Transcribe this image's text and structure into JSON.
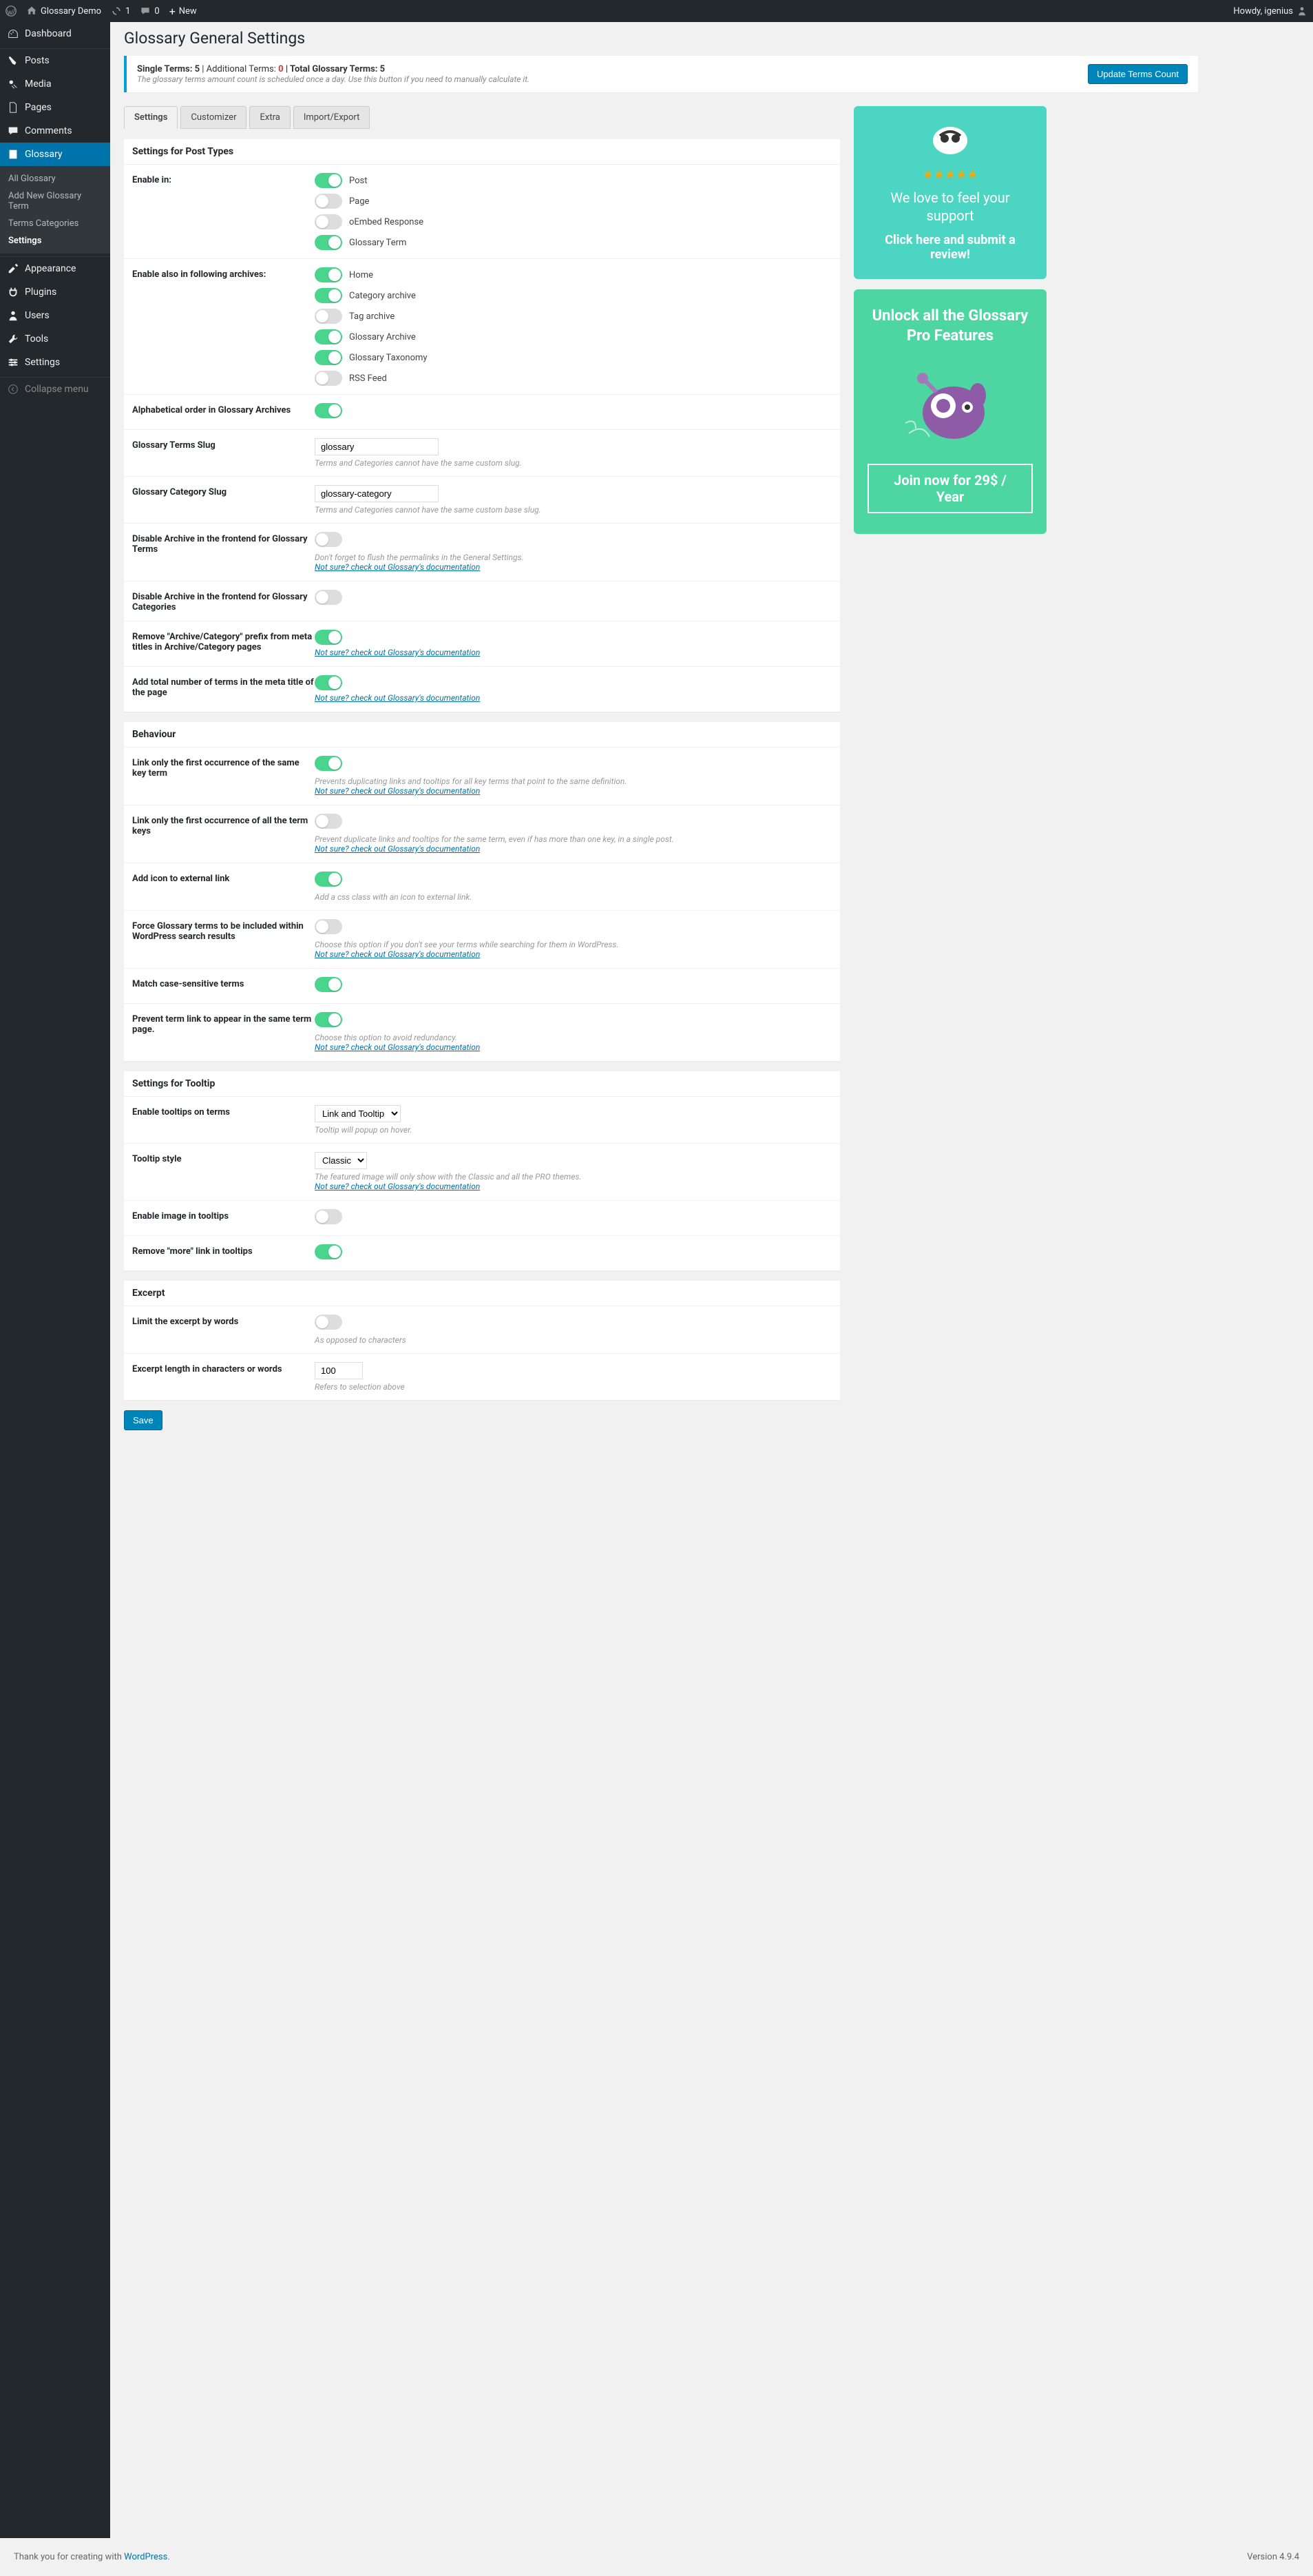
{
  "adminbar": {
    "site": "Glossary Demo",
    "updates": "1",
    "comments": "0",
    "new": "New",
    "howdy": "Howdy, igenius"
  },
  "sidebar": {
    "items": [
      "Dashboard",
      "Posts",
      "Media",
      "Pages",
      "Comments",
      "Glossary",
      "Appearance",
      "Plugins",
      "Users",
      "Tools",
      "Settings"
    ],
    "sub": [
      "All Glossary",
      "Add New Glossary Term",
      "Terms Categories",
      "Settings"
    ],
    "collapse": "Collapse menu"
  },
  "page": {
    "title": "Glossary General Settings",
    "notice_a": "Single Terms: ",
    "notice_av": "5",
    "notice_b": " | Additional Terms: ",
    "notice_bv": "0",
    "notice_c": " | Total Glossary Terms: ",
    "notice_cv": "5",
    "notice_sub": "The glossary terms amount count is scheduled once a day. Use this button if you need to manually calculate it.",
    "update_btn": "Update Terms Count",
    "tabs": [
      "Settings",
      "Customizer",
      "Extra",
      "Import/Export"
    ],
    "sec1": "Settings for Post Types",
    "r1": "Enable in:",
    "r1o": [
      "Post",
      "Page",
      "oEmbed Response",
      "Glossary Term"
    ],
    "r2": "Enable also in following archives:",
    "r2o": [
      "Home",
      "Category archive",
      "Tag archive",
      "Glossary Archive",
      "Glossary Taxonomy",
      "RSS Feed"
    ],
    "r3": "Alphabetical order in Glossary Archives",
    "r4": "Glossary Terms Slug",
    "r4v": "glossary",
    "r4h": "Terms and Categories cannot have the same custom slug.",
    "r5": "Glossary Category Slug",
    "r5v": "glossary-category",
    "r5h": "Terms and Categories cannot have the same custom base slug.",
    "r6": "Disable Archive in the frontend for Glossary Terms",
    "r6h": "Don't forget to flush the permalinks in the General Settings.",
    "r7": "Disable Archive in the frontend for Glossary Categories",
    "r8": "Remove \"Archive/Category\" prefix from meta titles in Archive/Category pages",
    "r9": "Add total number of terms in the meta title of the page",
    "doclink": "Not sure? check out Glossary's documentation",
    "sec2": "Behaviour",
    "b1": "Link only the first occurrence of the same key term",
    "b1h": "Prevents duplicating links and tooltips for all key terms that point to the same definition.",
    "b2": "Link only the first occurrence of all the term keys",
    "b2h": "Prevent duplicate links and tooltips for the same term, even if has more than one key, in a single post.",
    "b3": "Add icon to external link",
    "b3h": "Add a css class with an icon to external link.",
    "b4": "Force Glossary terms to be included within WordPress search results",
    "b4h": "Choose this option if you don't see your terms while searching for them in WordPress.",
    "b5": "Match case-sensitive terms",
    "b6": "Prevent term link to appear in the same term page.",
    "b6h": "Choose this option to avoid redundancy.",
    "sec3": "Settings for Tooltip",
    "t1": "Enable tooltips on terms",
    "t1v": "Link and Tooltip",
    "t1h": "Tooltip will popup on hover.",
    "t2": "Tooltip style",
    "t2v": "Classic",
    "t2h": "The featured image will only show with the Classic and all the PRO themes.",
    "t3": "Enable image in tooltips",
    "t4": "Remove \"more\" link in tooltips",
    "sec4": "Excerpt",
    "e1": "Limit the excerpt by words",
    "e1h": "As opposed to characters",
    "e2": "Excerpt length in characters or words",
    "e2v": "100",
    "e2h": "Refers to selection above",
    "save": "Save"
  },
  "promo1": {
    "p1": "We love to feel your support",
    "p2": "Click here and submit a review!"
  },
  "promo2": {
    "p1": "Unlock all the Glossary Pro Features",
    "price": "Join now for 29$ / Year"
  },
  "footer": {
    "txt": "Thank you for creating with ",
    "link": "WordPress",
    "ver": "Version 4.9.4"
  }
}
